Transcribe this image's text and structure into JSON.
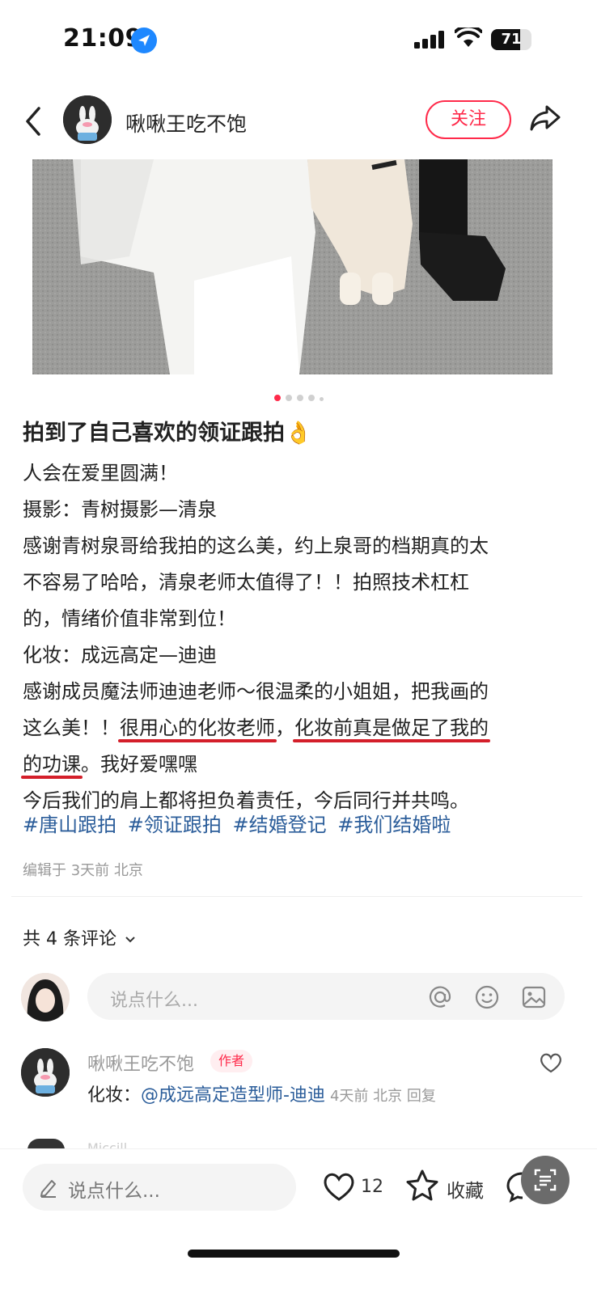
{
  "status_bar": {
    "time": "21:09",
    "battery": "71",
    "battery_level": 0.71
  },
  "nav": {
    "author_name": "啾啾王吃不饱",
    "follow_label": "关注"
  },
  "carousel": {
    "dot_count": 5,
    "active_index": 0
  },
  "post": {
    "title": "拍到了自己喜欢的领证跟拍👌",
    "line1": "人会在爱里圆满！",
    "line2": "摄影：青树摄影—清泉",
    "line3": "感谢青树泉哥给我拍的这么美，约上泉哥的档期真的太",
    "line4": "不容易了哈哈，清泉老师太值得了！！拍照技术杠杠",
    "line5": "的，情绪价值非常到位！",
    "line6": "化妆：成远高定—迪迪",
    "line7": "感谢成员魔法师迪迪老师～很温柔的小姐姐，把我画的",
    "line8_a": "这么美！！",
    "line8_b": "很用心的化妆老师",
    "line8_c": "，",
    "line8_d": "化妆前真是做足了我的",
    "line9_a": "的功课",
    "line9_b": "。我好爱嘿嘿",
    "line10": "今后我们的肩上都将担负着责任，今后同行并共鸣。",
    "tags": [
      "#唐山跟拍",
      "#领证跟拍",
      "#结婚登记",
      "#我们结婚啦"
    ],
    "meta": "编辑于 3天前 北京"
  },
  "comments": {
    "count_label": "共 4 条评论",
    "input_placeholder": "说点什么...",
    "items": [
      {
        "name": "啾啾王吃不饱",
        "badge": "作者",
        "prefix": "化妆：",
        "mention": "@成远高定造型师-迪迪",
        "meta": "4天前 北京 回复"
      }
    ],
    "next_name": "Miccill"
  },
  "bottom_bar": {
    "placeholder": "说点什么...",
    "likes": "12",
    "favorite_label": "收藏"
  },
  "colors": {
    "accent": "#ff2a4a",
    "link": "#2b5d9a",
    "underline": "#d41f2a"
  }
}
